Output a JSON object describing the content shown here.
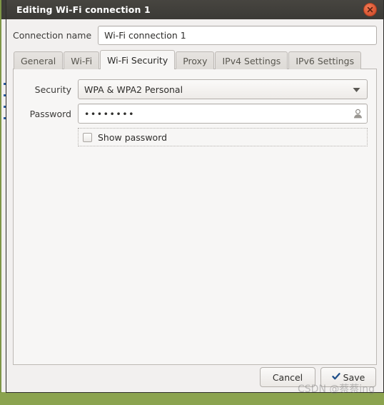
{
  "window": {
    "title": "Editing Wi-Fi connection 1",
    "close_icon": "close-icon"
  },
  "connection": {
    "label": "Connection name",
    "value": "Wi-Fi connection 1",
    "placeholder": "Connection name"
  },
  "tabs": [
    {
      "label": "General",
      "active": false
    },
    {
      "label": "Wi-Fi",
      "active": false
    },
    {
      "label": "Wi-Fi Security",
      "active": true
    },
    {
      "label": "Proxy",
      "active": false
    },
    {
      "label": "IPv4 Settings",
      "active": false
    },
    {
      "label": "IPv6 Settings",
      "active": false
    }
  ],
  "security": {
    "label": "Security",
    "selected": "WPA & WPA2 Personal",
    "arrow_icon": "chevron-down-icon",
    "options": [
      "WPA & WPA2 Personal"
    ]
  },
  "password": {
    "label": "Password",
    "value": "••••••••",
    "placeholder": "",
    "reveal_icon": "user-person-icon"
  },
  "show_password": {
    "label": "Show password",
    "checked": false
  },
  "footer": {
    "cancel_label": "Cancel",
    "save_label": "Save",
    "save_icon": "check-icon"
  },
  "watermark": {
    "text": "CSDN @蔡蔡ing"
  },
  "colors": {
    "titlebar": "#3b3a36",
    "close_button": "#e2613c",
    "panel": "#f7f6f5",
    "dialog_bg": "#f2f0ef",
    "desktop": "#8ba34f",
    "text": "#2e2d2b"
  }
}
